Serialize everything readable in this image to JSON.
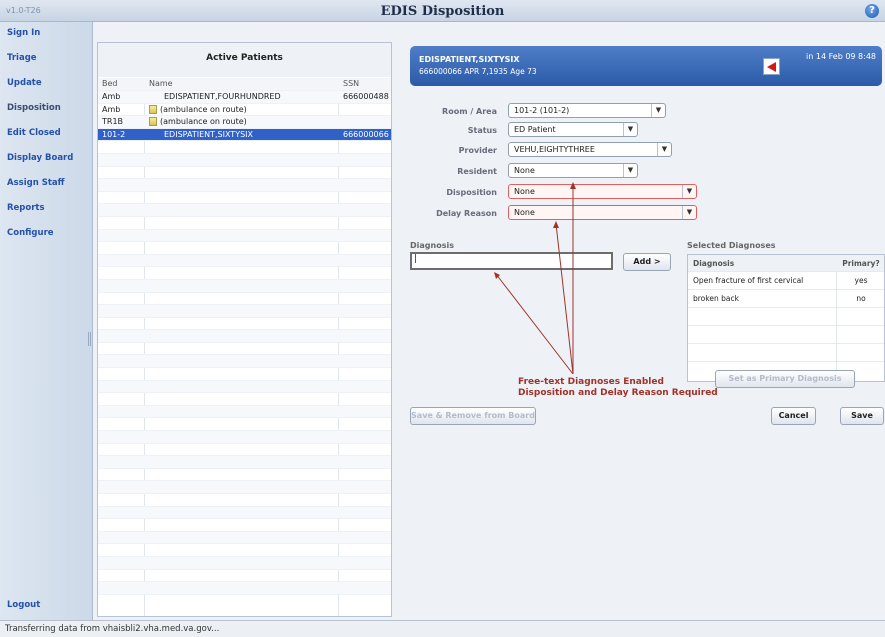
{
  "app": {
    "version": "v1.0-T26",
    "title": "EDIS Disposition",
    "help_label": "?"
  },
  "sidebar": {
    "items": [
      {
        "label": "Sign In"
      },
      {
        "label": "Triage"
      },
      {
        "label": "Update"
      },
      {
        "label": "Disposition"
      },
      {
        "label": "Edit Closed"
      },
      {
        "label": "Display Board"
      },
      {
        "label": "Assign Staff"
      },
      {
        "label": "Reports"
      },
      {
        "label": "Configure"
      }
    ],
    "logout": "Logout"
  },
  "patients": {
    "title": "Active Patients",
    "columns": [
      "Bed",
      "Name",
      "SSN"
    ],
    "rows": [
      {
        "bed": "Amb",
        "name": "EDISPATIENT,FOURHUNDRED",
        "ssn": "666000488",
        "icon": "",
        "selected": false
      },
      {
        "bed": "Amb",
        "name": "(ambulance on route)",
        "ssn": "",
        "icon": "document-icon",
        "selected": false
      },
      {
        "bed": "TR1B",
        "name": "(ambulance on route)",
        "ssn": "",
        "icon": "document-icon",
        "selected": false
      },
      {
        "bed": "101-2",
        "name": "EDISPATIENT,SIXTYSIX",
        "ssn": "666000066",
        "icon": "",
        "selected": true
      }
    ]
  },
  "banner": {
    "name": "EDISPATIENT,SIXTYSIX",
    "ids": "666000066  APR 7,1935  Age 73",
    "arrival": "in 14 Feb 09 8:48",
    "flag_icon": "red-flag-icon"
  },
  "form": {
    "room": {
      "label": "Room / Area",
      "value": "101-2  (101-2)"
    },
    "status": {
      "label": "Status",
      "value": "ED Patient"
    },
    "provider": {
      "label": "Provider",
      "value": "VEHU,EIGHTYTHREE"
    },
    "resident": {
      "label": "Resident",
      "value": "None"
    },
    "disposition": {
      "label": "Disposition",
      "value": "None"
    },
    "delay": {
      "label": "Delay Reason",
      "value": "None"
    }
  },
  "diagnosis": {
    "label": "Diagnosis",
    "input_value": "|",
    "add_button": "Add >",
    "selected_label": "Selected Diagnoses",
    "table_headers": [
      "Diagnosis",
      "Primary?"
    ],
    "rows": [
      {
        "diagnosis": "Open fracture of first cervical",
        "primary": "yes"
      },
      {
        "diagnosis": "broken back",
        "primary": "no"
      }
    ],
    "set_primary_button": "Set as Primary Diagnosis"
  },
  "annotation": {
    "line1": "Free-text Diagnoses Enabled",
    "line2": "Disposition and Delay Reason Required"
  },
  "buttons": {
    "save_remove": "Save & Remove from Board",
    "cancel": "Cancel",
    "save": "Save"
  },
  "status_bar": "Transferring data from vhaisbli2.vha.med.va.gov...",
  "colors": {
    "banner": "#2b5aa8",
    "selected_row": "#2f61c9",
    "annotation": "#a0322a",
    "required_border": "#e06060"
  }
}
